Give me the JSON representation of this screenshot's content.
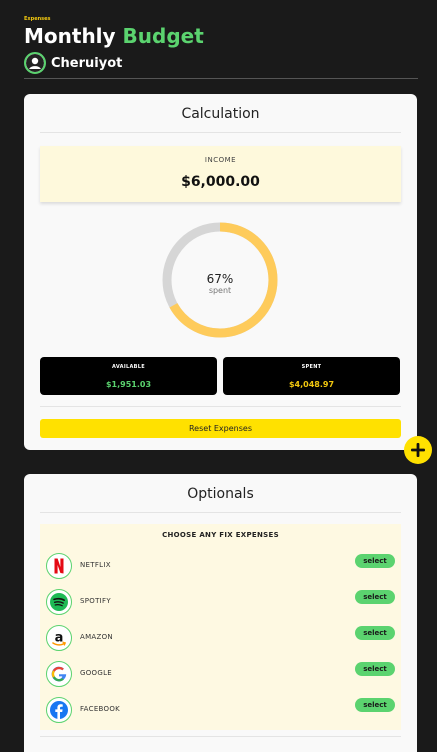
{
  "header": {
    "tiny_label": "Expenses",
    "title_prefix": "Monthly",
    "title_accent": "Budget",
    "user_name": "Cheruiyot"
  },
  "calculation": {
    "title": "Calculation",
    "income_label": "INCOME",
    "income_value": "$6,000.00",
    "spent_fraction": 0.67,
    "spent_percent_label": "67%",
    "spent_caption": "spent",
    "available_label": "AVAILABLE",
    "available_value": "$1,951.03",
    "spent_label": "SPENT",
    "spent_value": "$4,048.97",
    "reset_label": "Reset Expenses"
  },
  "optionals": {
    "title": "Optionals",
    "heading": "CHOOSE ANY FIX EXPENSES",
    "items": [
      {
        "name": "NETFLIX",
        "icon": "netflix-icon",
        "action": "select"
      },
      {
        "name": "SPOTIFY",
        "icon": "spotify-icon",
        "action": "select"
      },
      {
        "name": "AMAZON",
        "icon": "amazon-icon",
        "action": "select"
      },
      {
        "name": "GOOGLE",
        "icon": "google-icon",
        "action": "select"
      },
      {
        "name": "FACEBOOK",
        "icon": "facebook-icon",
        "action": "select"
      }
    ]
  },
  "colors": {
    "background": "#1a1a1a",
    "accent_green": "#5bd36f",
    "accent_yellow": "#ffe100",
    "donut_fill": "#fecb5b",
    "donut_track": "#d6d6d6"
  }
}
